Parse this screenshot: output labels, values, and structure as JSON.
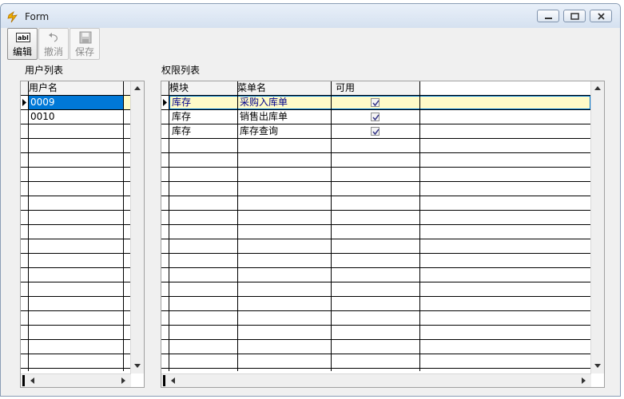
{
  "window": {
    "title": "Form"
  },
  "toolbar": {
    "edit_label": "编辑",
    "undo_label": "撤消",
    "save_label": "保存"
  },
  "users_panel": {
    "label": "用户列表",
    "column": "用户名",
    "rows": [
      "0009",
      "0010"
    ]
  },
  "perms_panel": {
    "label": "权限列表",
    "columns": {
      "module": "模块",
      "menu": "菜单名",
      "enabled": "可用"
    },
    "rows": [
      {
        "module": "库存",
        "menu": "采购入库单",
        "enabled": true
      },
      {
        "module": "库存",
        "menu": "销售出库单",
        "enabled": true
      },
      {
        "module": "库存",
        "menu": "库存查询",
        "enabled": true
      }
    ]
  },
  "colors": {
    "selection": "#0078d7",
    "current_row": "#fffbc8",
    "grid_line": "#000000"
  }
}
